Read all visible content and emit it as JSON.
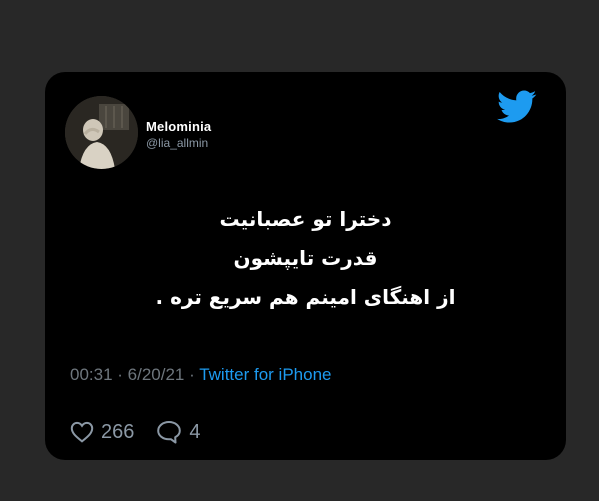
{
  "tweet": {
    "display_name": "Melominia",
    "handle": "@lia_allmin",
    "body_lines": [
      "دخترا تو عصبانیت",
      "قدرت تایپشون",
      "از اهنگای امینم هم سریع تره ."
    ],
    "time": "00:31",
    "separator_1": " · ",
    "date": "6/20/21",
    "separator_2": " · ",
    "source": "Twitter for iPhone",
    "likes": "266",
    "replies": "4"
  },
  "icons": {
    "brand": "twitter-bird-icon",
    "like": "heart-outline-icon",
    "reply": "speech-bubble-icon"
  },
  "colors": {
    "background": "#282828",
    "card": "#000000",
    "brand": "#1d9bf0",
    "muted": "#6e767d",
    "text": "#ffffff"
  }
}
